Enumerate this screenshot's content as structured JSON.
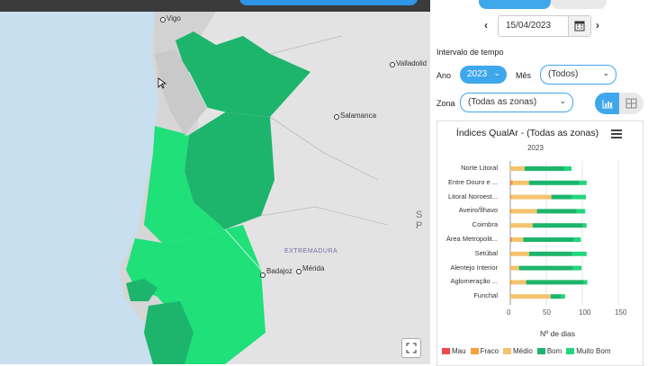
{
  "map": {
    "cities": [
      "Vigo",
      "Valladolid",
      "Salamanca",
      "Badajoz",
      "Mérida"
    ],
    "region_label": "EXTREMADURA",
    "country_label": "S P",
    "colors": {
      "bom": "#1db46c",
      "muito_bom": "#1fe079",
      "land": "#d6d6d6"
    }
  },
  "panel": {
    "date": "15/04/2023",
    "prev": "‹",
    "next": "›",
    "interval_label": "Intervalo de tempo",
    "ano_label": "Ano",
    "ano_value": "2023",
    "mes_label": "Mês",
    "mes_value": "(Todos)",
    "zona_label": "Zona",
    "zona_value": "(Todas as zonas)",
    "icons": {
      "chart": "bar-chart-icon",
      "table": "table-icon",
      "calendar": "calendar-icon",
      "menu": "menu-icon",
      "expand": "expand-icon"
    }
  },
  "chart_data": {
    "type": "bar",
    "stacked": true,
    "orientation": "horizontal",
    "title": "Índices QualAr - (Todas as zonas)",
    "subtitle": "2023",
    "xlabel": "Nº de dias",
    "xlim": [
      0,
      150
    ],
    "xticks": [
      "0",
      "50",
      "100",
      "150"
    ],
    "categories": [
      "Norte Litoral",
      "Entre Douro e ...",
      "Litoral Noroest...",
      "Aveiro/Ílhavo",
      "Coimbra",
      "Área Metropolit...",
      "Setúbal",
      "Alentejo Interior",
      "Aglomeração ...",
      "Funchal"
    ],
    "series": [
      {
        "name": "Mau",
        "color": "#f04a4a",
        "values": [
          0,
          1,
          0,
          0,
          0,
          1,
          0,
          0,
          0,
          0
        ]
      },
      {
        "name": "Fraco",
        "color": "#f4a23a",
        "values": [
          0,
          3,
          2,
          2,
          1,
          2,
          1,
          0,
          2,
          1
        ]
      },
      {
        "name": "Médio",
        "color": "#f4c36e",
        "values": [
          20,
          22,
          55,
          35,
          30,
          15,
          25,
          12,
          20,
          55
        ]
      },
      {
        "name": "Bom",
        "color": "#1db46c",
        "values": [
          55,
          70,
          28,
          55,
          70,
          70,
          60,
          75,
          80,
          15
        ]
      },
      {
        "name": "Muito Bom",
        "color": "#22d67a",
        "values": [
          10,
          10,
          20,
          12,
          5,
          10,
          20,
          12,
          5,
          5
        ]
      }
    ]
  }
}
